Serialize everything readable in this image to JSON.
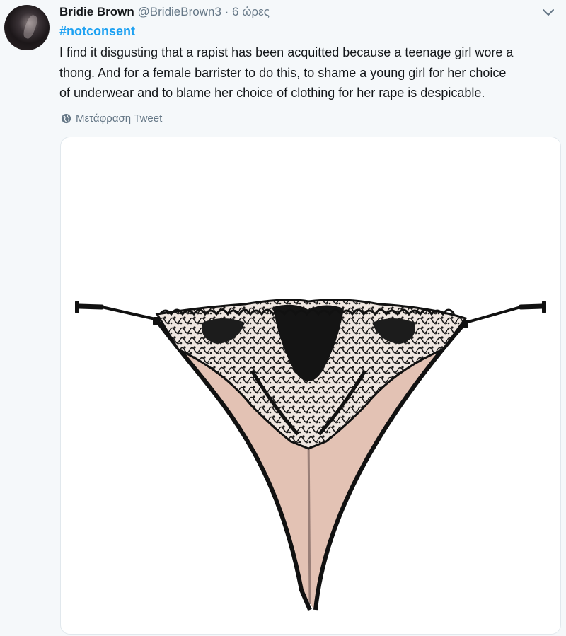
{
  "tweet": {
    "author_name": "Bridie Brown",
    "author_handle": "@BridieBrown3",
    "separator": "·",
    "timestamp": "6 ώρες",
    "hashtag": "#notconsent",
    "text_lines": [
      "I find it disgusting that a rapist has been acquitted because a teenage girl wore a",
      "thong. And for a female barrister to do this, to shame a young girl for her choice",
      "of underwear and to blame her choice of clothing for her rape is despicable."
    ],
    "translate_label": "Μετάφραση Tweet",
    "media_alt": "thong"
  },
  "icons": {
    "more": "chevron-down-icon",
    "translate": "globe-icon"
  },
  "colors": {
    "background": "#f5f8fa",
    "hashtag": "#1da1f2",
    "muted": "#657786",
    "text": "#14171a"
  }
}
